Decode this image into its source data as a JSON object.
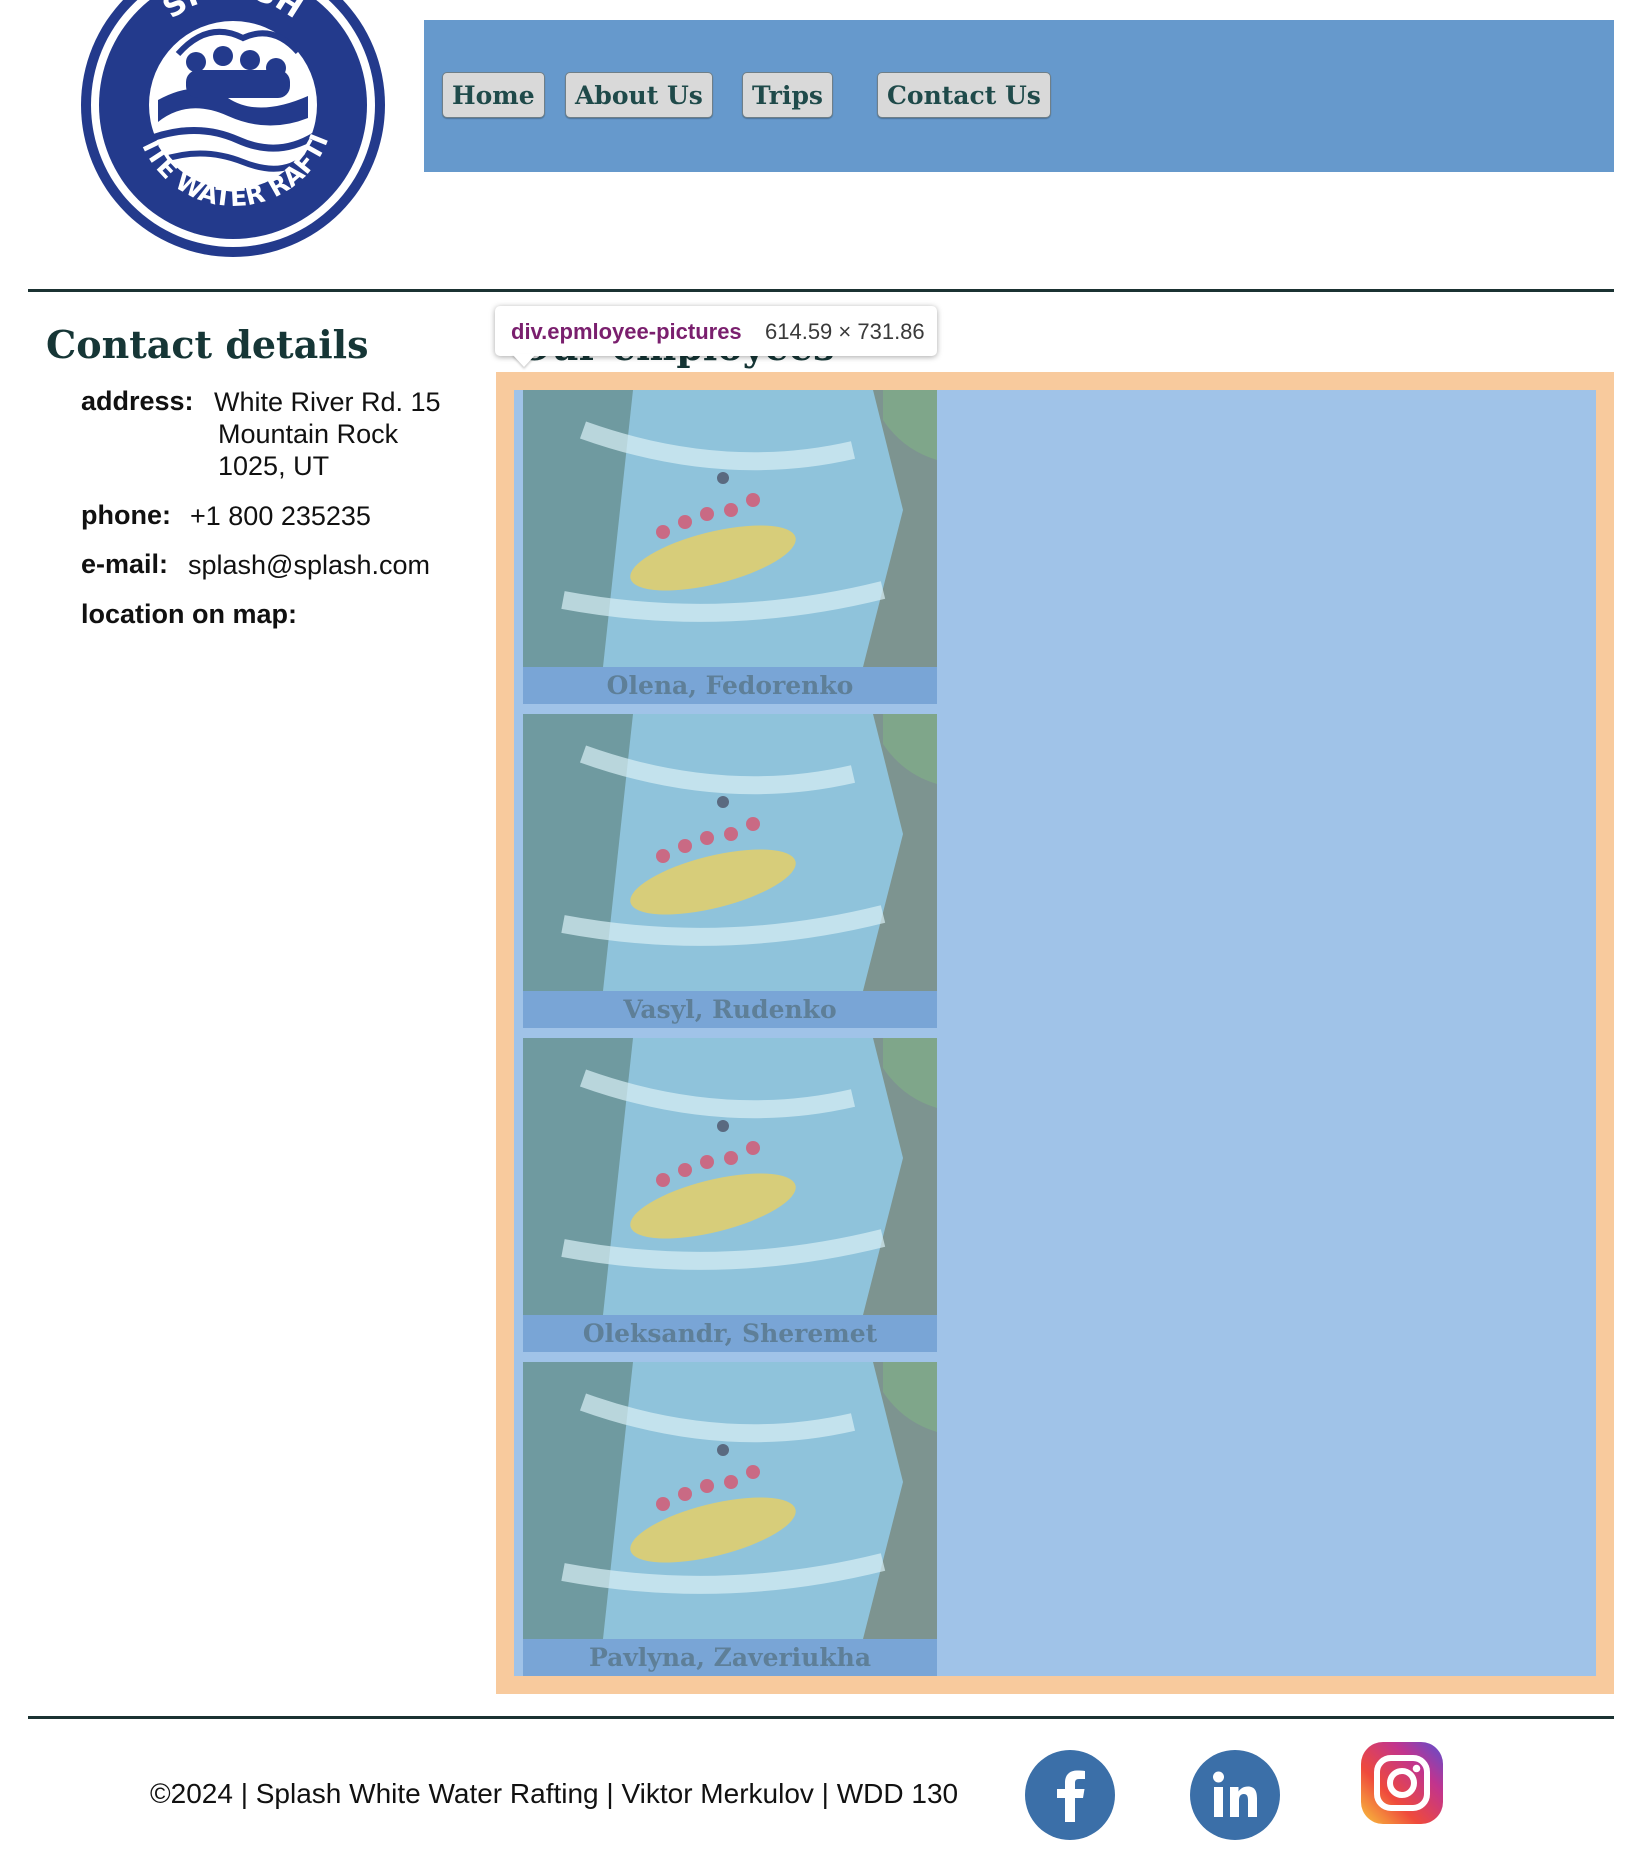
{
  "brand": {
    "logo_top": "SPLASH",
    "logo_bottom": "WHITE WATER RAFTING"
  },
  "nav": {
    "items": [
      {
        "label": "Home"
      },
      {
        "label": "About Us"
      },
      {
        "label": "Trips"
      },
      {
        "label": "Contact Us"
      }
    ]
  },
  "contact": {
    "title": "Contact details",
    "address_label": "address:",
    "address_lines": [
      "White River Rd. 15",
      "Mountain Rock",
      "1025, UT"
    ],
    "phone_label": "phone:",
    "phone": "+1 800 235235",
    "email_label": "e-mail:",
    "email": "splash@splash.com",
    "map_label": "location on map:"
  },
  "employees": {
    "title": "Our employees",
    "people": [
      {
        "name": "Olena, Fedorenko"
      },
      {
        "name": "Vasyl, Rudenko"
      },
      {
        "name": "Oleksandr, Sheremet"
      },
      {
        "name": "Pavlyna, Zaveriukha"
      }
    ]
  },
  "devtools_tooltip": {
    "selector": "div.epmloyee-pictures",
    "size": "614.59 × 731.86"
  },
  "footer": {
    "text": "©2024 | Splash White Water Rafting | Viktor Merkulov | WDD 130",
    "social_icons": [
      "facebook-icon",
      "linkedin-icon",
      "instagram-icon"
    ]
  },
  "colors": {
    "nav_bg": "#6699cc",
    "panel_bg": "#f8ca9d",
    "inner_bg": "#a0c3e8",
    "caption_bg": "#79a5d6",
    "heading": "#163636",
    "logo_blue": "#1f3f8f"
  }
}
